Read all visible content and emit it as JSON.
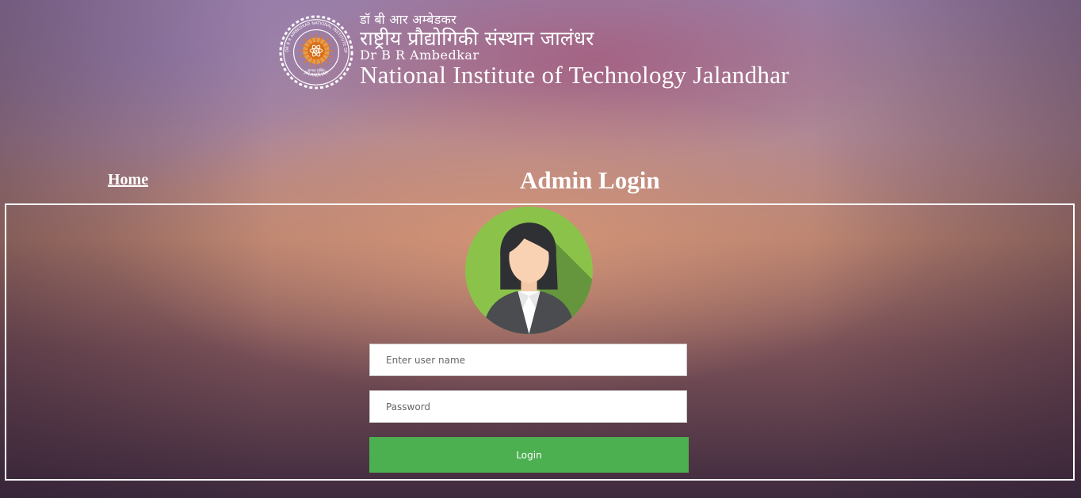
{
  "header": {
    "seal": {
      "icon": "institute-seal-icon",
      "ring_text": "DR B R AMBEDKAR NATIONAL INSTITUTE OF TECHNOLOGY",
      "bottom_text": "JALANDHAR",
      "hindi_motto": "ज्ञानात् मुक्तिः"
    },
    "hindi_line_small": "डॉ बी आर अम्बेडकर",
    "hindi_line_large": "राष्ट्रीय प्रौद्योगिकी संस्थान जालंधर",
    "english_line_small": "Dr B R Ambedkar",
    "english_line_large": "National Institute of Technology Jalandhar"
  },
  "nav": {
    "home_label": "Home"
  },
  "page": {
    "title": "Admin Login"
  },
  "login_form": {
    "avatar_icon": "user-avatar-icon",
    "username_placeholder": "Enter user name",
    "username_value": "",
    "password_placeholder": "Password",
    "password_value": "",
    "submit_label": "Login"
  },
  "colors": {
    "button": "#4caf50",
    "avatar_background": "#8bc34a",
    "text": "#ffffff"
  }
}
